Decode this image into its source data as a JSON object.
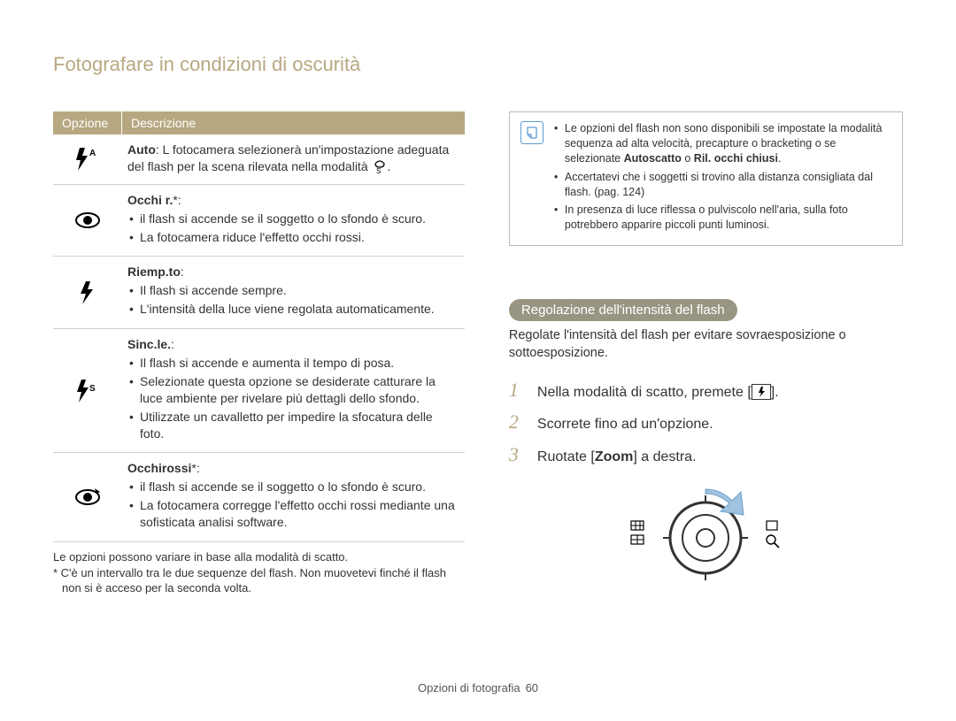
{
  "header": {
    "title": "Fotografare in condizioni di oscurità"
  },
  "table": {
    "headers": {
      "option": "Opzione",
      "description": "Descrizione"
    },
    "rows": {
      "auto": {
        "title": "Auto",
        "text": ":  L fotocamera selezionerà un'impostazione adeguata del flash per la scena rilevata nella modalità ",
        "icon_suffix": "."
      },
      "occhi_r": {
        "title": "Occhi r.",
        "suffix": "*:",
        "b1": "il flash si accende se il soggetto o lo sfondo è scuro.",
        "b2": "La fotocamera riduce l'effetto occhi rossi."
      },
      "riemp": {
        "title": "Riemp.to",
        "suffix": ":",
        "b1": "Il flash si accende sempre.",
        "b2": "L'intensità della luce viene regolata automaticamente."
      },
      "sinc": {
        "title": "Sinc.le.",
        "suffix": ":",
        "b1": "Il flash si accende e aumenta il tempo di posa.",
        "b2": "Selezionate questa opzione se desiderate catturare la luce ambiente per rivelare più dettagli dello sfondo.",
        "b3": "Utilizzate un cavalletto per impedire la sfocatura delle foto."
      },
      "occhirossi": {
        "title": "Occhirossi",
        "suffix": "*:",
        "b1": "il flash si accende se il soggetto o lo sfondo è scuro.",
        "b2": "La fotocamera corregge l'effetto occhi rossi mediante una sofisticata analisi software."
      }
    },
    "footnotes": {
      "f1": "Le opzioni possono variare in base alla modalità di scatto.",
      "f2": "* C'è un intervallo tra le due sequenze del flash. Non muovetevi finché il flash non si è acceso per la seconda volta."
    }
  },
  "note": {
    "b1_a": "Le opzioni del flash non sono disponibili se impostate la modalità sequenza ad alta velocità, precapture o bracketing o se selezionate ",
    "b1_bold1": "Autoscatto",
    "b1_mid": " o ",
    "b1_bold2": "Ril. occhi chiusi",
    "b1_end": ".",
    "b2": "Accertatevi che i soggetti si trovino alla distanza consigliata dal flash. (pag. 124)",
    "b3": "In presenza di luce riflessa o pulviscolo nell'aria, sulla foto potrebbero apparire piccoli punti luminosi."
  },
  "section": {
    "pill": "Regolazione dell'intensità del flash",
    "intro": "Regolate l'intensità del flash per evitare sovraesposizione o sottoesposizione."
  },
  "steps": {
    "s1a": "Nella modalità di scatto, premete [",
    "s1b": "].",
    "s2": "Scorrete fino ad un'opzione.",
    "s3a": "Ruotate [",
    "s3_bold": "Zoom",
    "s3b": "] a destra."
  },
  "footer": {
    "label": "Opzioni di fotografia",
    "page": "60"
  }
}
